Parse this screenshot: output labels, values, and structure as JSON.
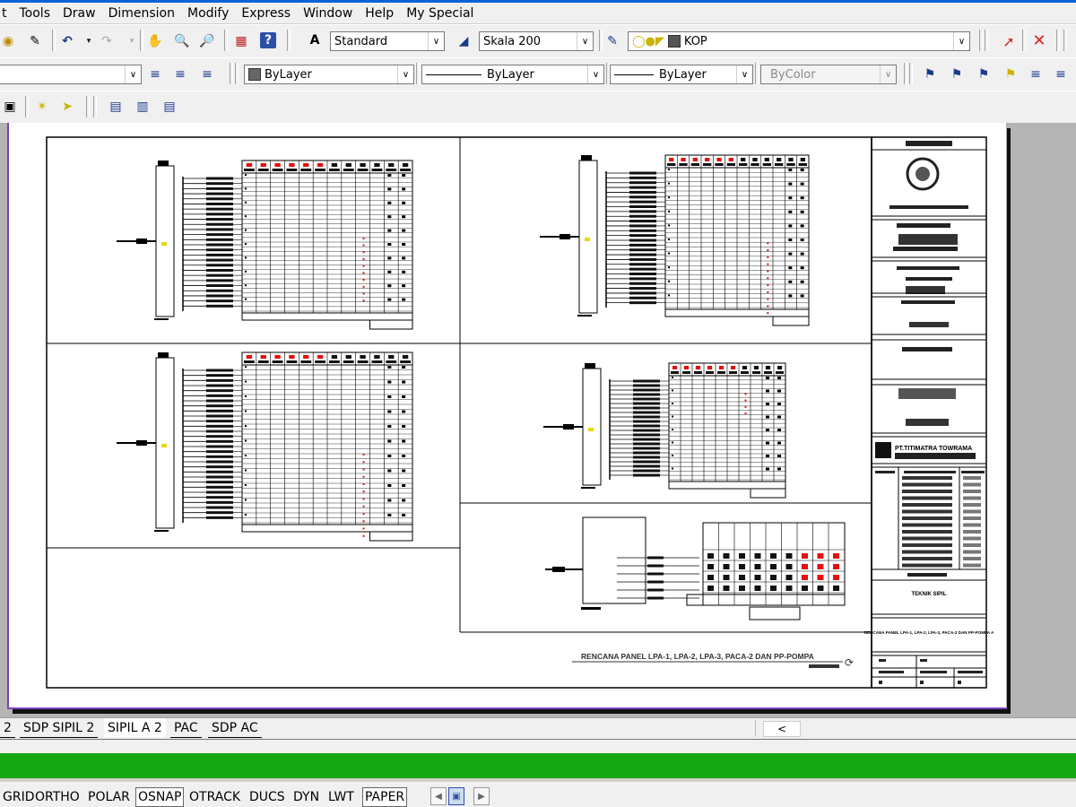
{
  "menu": [
    "t",
    "Tools",
    "Draw",
    "Dimension",
    "Modify",
    "Express",
    "Window",
    "Help",
    "My Special"
  ],
  "toolbar1": {
    "text_style": "Standard",
    "dim_style": "Skala 200",
    "layer": "KOP"
  },
  "toolbar2": {
    "color": "ByLayer",
    "linetype": "ByLayer",
    "lineweight": "ByLayer",
    "plotstyle": "ByColor"
  },
  "drawing": {
    "sheet_title": "RENCANA PANEL LPA-1, LPA-2, LPA-3, PACA-2 DAN PP-POMPA",
    "company": "PT.TITIMATRA TOWRAMA",
    "dept": "TEKNIK SIPIL",
    "title_block_desc": "RENCANA PANEL LPA-1, LPA-2, LPA-3, PACA-2 DAN PP-POMPA A"
  },
  "tabs": [
    "2",
    "SDP SIPIL 2",
    "SIPIL A 2",
    "PAC",
    "SDP AC"
  ],
  "active_tab": "SIPIL A 2",
  "status": [
    "GRID",
    "ORTHO",
    "POLAR",
    "OSNAP",
    "OTRACK",
    "DUCS",
    "DYN",
    "LWT",
    "PAPER"
  ],
  "status_on": [
    "OSNAP",
    "PAPER"
  ],
  "colors": {
    "accent_green": "#14a814",
    "paper_border": "#7b3fbf",
    "highlight_red": "#e01010"
  }
}
